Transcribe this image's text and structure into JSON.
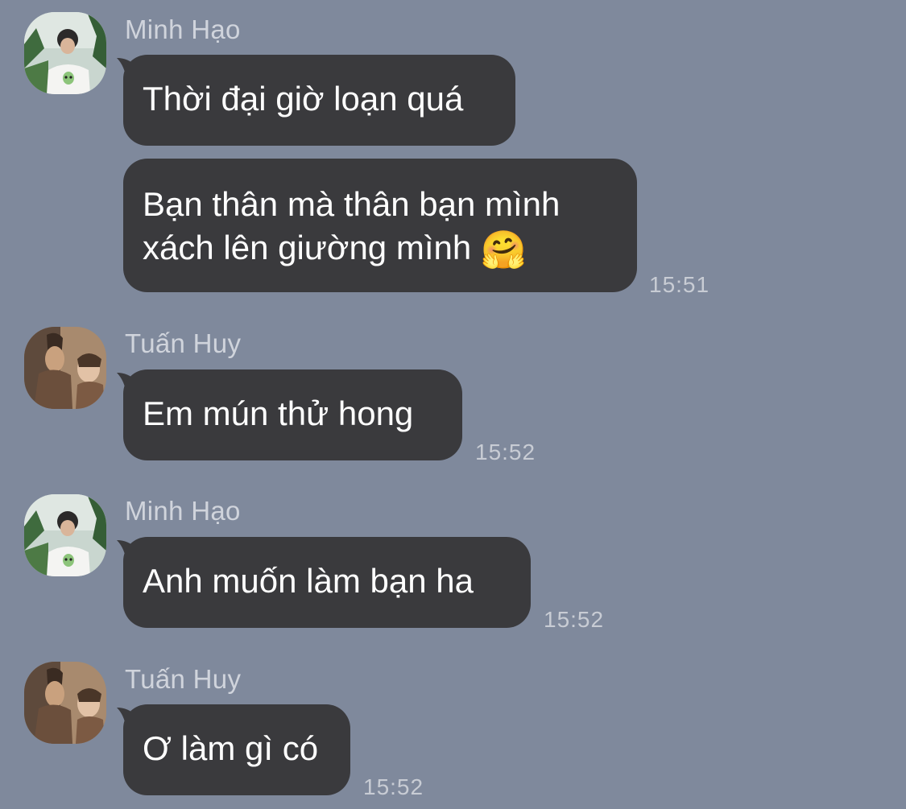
{
  "messages": [
    {
      "sender": "Minh Hạo",
      "bubbles": [
        {
          "text": "Thời đại giờ loạn quá"
        },
        {
          "line1": "Bạn thân mà thân bạn mình",
          "line2": "xách lên giường mình",
          "emoji": "🤗"
        }
      ],
      "time": "15:51"
    },
    {
      "sender": "Tuấn Huy",
      "bubbles": [
        {
          "text": "Em mún thử hong"
        }
      ],
      "time": "15:52"
    },
    {
      "sender": "Minh Hạo",
      "bubbles": [
        {
          "text": "Anh muốn làm bạn ha"
        }
      ],
      "time": "15:52"
    },
    {
      "sender": "Tuấn Huy",
      "bubbles": [
        {
          "text": "Ơ làm gì có"
        }
      ],
      "time": "15:52"
    }
  ],
  "colors": {
    "background": "#7f899c",
    "bubble": "#3a3a3d",
    "bubble_text": "#ffffff",
    "sender_text": "#d0d4dc",
    "time_text": "#c8ccd4"
  }
}
